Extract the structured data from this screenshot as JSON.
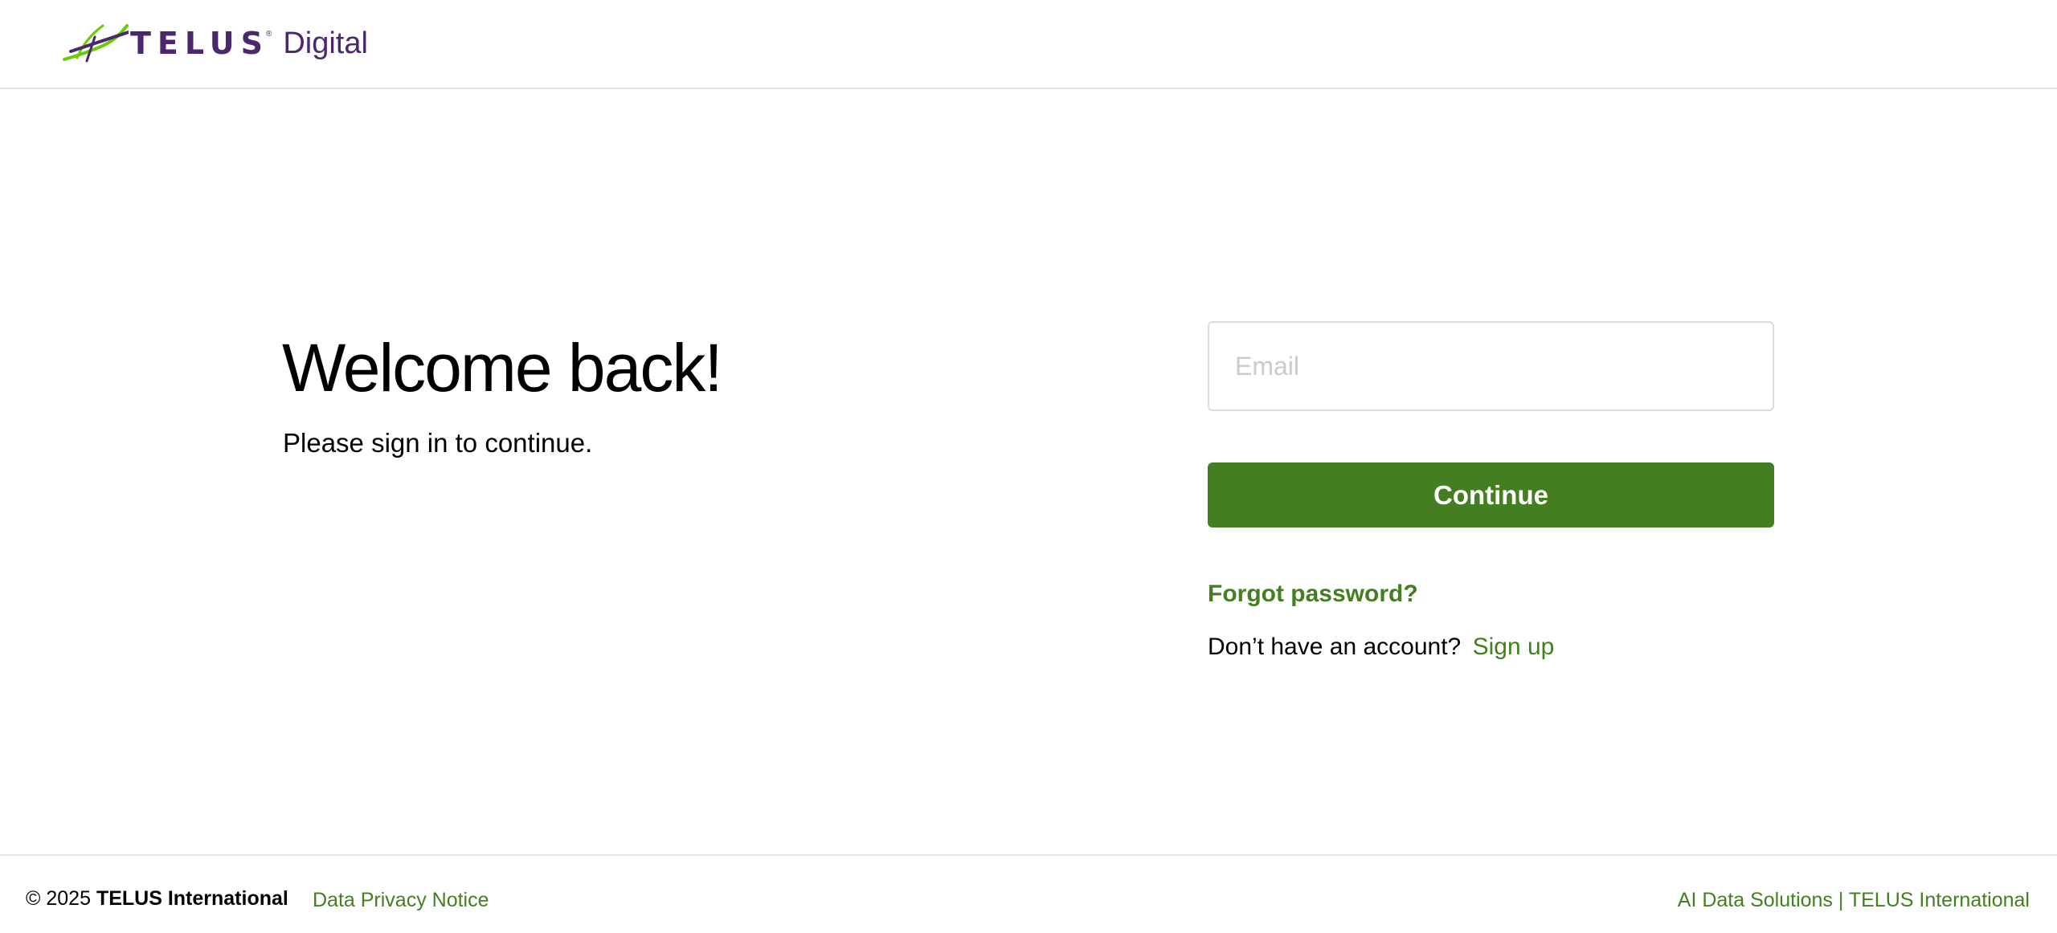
{
  "header": {
    "logo": {
      "brand": "TELUS",
      "registered": "®",
      "product": "Digital",
      "icon": "telus-swoosh-icon"
    }
  },
  "welcome": {
    "title": "Welcome back!",
    "subtitle": "Please sign in to continue."
  },
  "form": {
    "email": {
      "value": "",
      "placeholder": "Email"
    },
    "continue_label": "Continue",
    "forgot_password": "Forgot password?",
    "signup_prompt": "Don’t have an account?",
    "signup_link": "Sign up"
  },
  "footer": {
    "copyright_prefix": "© 2025",
    "copyright_company": "TELUS International",
    "privacy_link": "Data Privacy Notice",
    "solutions_link": "AI Data Solutions | TELUS International"
  },
  "colors": {
    "brand_purple": "#4b286d",
    "brand_green": "#437f21",
    "logo_light_green": "#66cc00",
    "border": "#e3e3e3",
    "placeholder": "#c9cbcd"
  }
}
